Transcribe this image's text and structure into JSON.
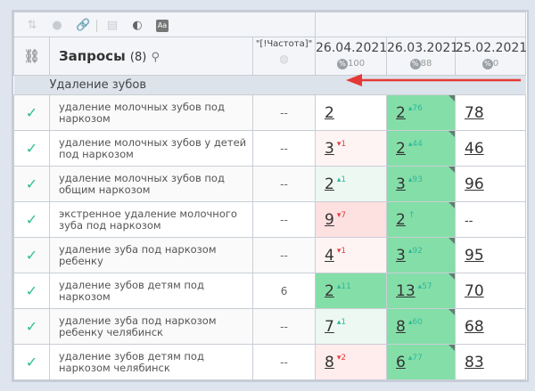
{
  "toolbar": {
    "icons": [
      "sort-icon",
      "toggle-icon",
      "link-icon",
      "calendar-icon",
      "contrast-icon",
      "font-icon"
    ]
  },
  "header": {
    "queries_label": "Запросы",
    "queries_count": "(8)",
    "freq_label": "\"[!Частота]\"",
    "dates": [
      {
        "date": "26.04.2021",
        "pct": "100"
      },
      {
        "date": "26.03.2021",
        "pct": "88"
      },
      {
        "date": "25.02.2021",
        "pct": "0"
      }
    ]
  },
  "group": {
    "name": "Удаление зубов"
  },
  "colors": {
    "accent_check": "#2bbf8f",
    "green_cell": "#84dea8",
    "pink_cell": "#fde0e0",
    "arrow": "#e53935"
  },
  "rows": [
    {
      "query": "удаление молочных зубов под наркозом",
      "freq": "--",
      "c1": {
        "v": "2",
        "d": "",
        "dir": "",
        "bg": "#ffffff"
      },
      "c2": {
        "v": "2",
        "d": "▴76",
        "dir": "up"
      },
      "c3": "78"
    },
    {
      "query": "удаление молочных зубов у детей под наркозом",
      "freq": "--",
      "c1": {
        "v": "3",
        "d": "▾1",
        "dir": "dn",
        "bg": "#fff4f4"
      },
      "c2": {
        "v": "2",
        "d": "▴44",
        "dir": "up"
      },
      "c3": "46"
    },
    {
      "query": "удаление молочных зубов под общим наркозом",
      "freq": "--",
      "c1": {
        "v": "2",
        "d": "▴1",
        "dir": "up",
        "bg": "#eef8f2"
      },
      "c2": {
        "v": "3",
        "d": "▴93",
        "dir": "up"
      },
      "c3": "96"
    },
    {
      "query": "экстренное удаление молочного зуба под наркозом",
      "freq": "--",
      "c1": {
        "v": "9",
        "d": "▾7",
        "dir": "dn",
        "bg": "#fde0e0"
      },
      "c2": {
        "v": "2",
        "d": "↑",
        "dir": "up"
      },
      "c3": "--"
    },
    {
      "query": "удаление зуба под наркозом ребенку",
      "freq": "--",
      "c1": {
        "v": "4",
        "d": "▾1",
        "dir": "dn",
        "bg": "#fff4f4"
      },
      "c2": {
        "v": "3",
        "d": "▴92",
        "dir": "up"
      },
      "c3": "95"
    },
    {
      "query": "удаление зубов детям под наркозом",
      "freq": "6",
      "c1": {
        "v": "2",
        "d": "▴11",
        "dir": "up",
        "bg": "#84dea8"
      },
      "c2": {
        "v": "13",
        "d": "▴57",
        "dir": "up"
      },
      "c3": "70"
    },
    {
      "query": "удаление зуба под наркозом ребенку челябинск",
      "freq": "--",
      "c1": {
        "v": "7",
        "d": "▴1",
        "dir": "up",
        "bg": "#eef8f2"
      },
      "c2": {
        "v": "8",
        "d": "▴60",
        "dir": "up"
      },
      "c3": "68"
    },
    {
      "query": "удаление зубов детям под наркозом челябинск",
      "freq": "--",
      "c1": {
        "v": "8",
        "d": "▾2",
        "dir": "dn",
        "bg": "#ffecec"
      },
      "c2": {
        "v": "6",
        "d": "▴77",
        "dir": "up"
      },
      "c3": "83"
    }
  ]
}
